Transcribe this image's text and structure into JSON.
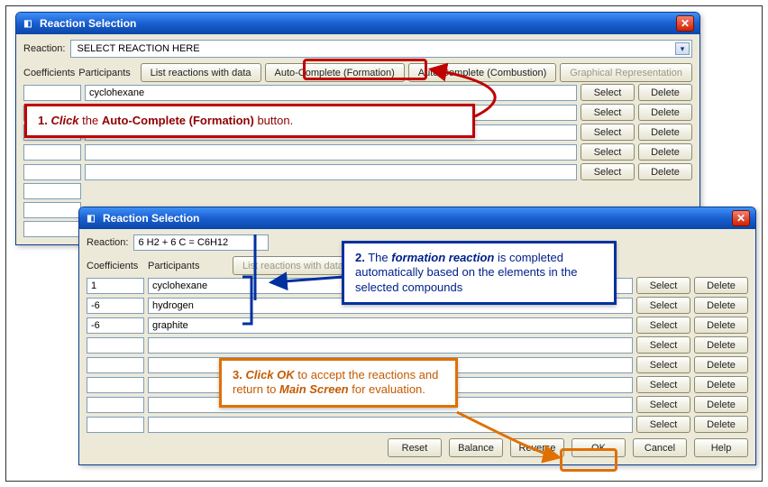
{
  "window1": {
    "title": "Reaction Selection",
    "reaction_label": "Reaction:",
    "reaction_value": "SELECT REACTION HERE",
    "cols": {
      "coef": "Coefficients",
      "part": "Participants"
    },
    "toolbar": {
      "list": "List reactions with data",
      "auto_form": "Auto-Complete (Formation)",
      "auto_comb": "Auto-Complete (Combustion)",
      "graph": "Graphical Representation"
    },
    "rows": [
      {
        "coef": "",
        "part": "cyclohexane"
      },
      {
        "coef": "",
        "part": ""
      },
      {
        "coef": "",
        "part": ""
      },
      {
        "coef": "",
        "part": ""
      },
      {
        "coef": "",
        "part": ""
      }
    ],
    "extra_coefs": [
      "",
      "",
      ""
    ],
    "btn": {
      "select": "Select",
      "delete": "Delete"
    }
  },
  "window2": {
    "title": "Reaction Selection",
    "reaction_label": "Reaction:",
    "reaction_value": "6 H2 + 6 C  =  C6H12",
    "cols": {
      "coef": "Coefficients",
      "part": "Participants"
    },
    "toolbar": {
      "list": "List reactions with data"
    },
    "rows": [
      {
        "coef": "1",
        "part": "cyclohexane"
      },
      {
        "coef": "-6",
        "part": "hydrogen"
      },
      {
        "coef": "-6",
        "part": "graphite"
      },
      {
        "coef": "",
        "part": ""
      },
      {
        "coef": "",
        "part": ""
      },
      {
        "coef": "",
        "part": ""
      },
      {
        "coef": "",
        "part": ""
      },
      {
        "coef": "",
        "part": ""
      }
    ],
    "btn": {
      "select": "Select",
      "delete": "Delete"
    },
    "strip": {
      "reset": "Reset",
      "balance": "Balance",
      "reverse": "Reverse",
      "ok": "OK",
      "cancel": "Cancel",
      "help": "Help"
    }
  },
  "callouts": {
    "c1": {
      "num": "1.",
      "t1": "Click",
      "t2": " the ",
      "t3": "Auto-Complete (Formation)",
      "t4": " button."
    },
    "c2": {
      "num": "2.",
      "t1": " The ",
      "t2": "formation reaction",
      "t3": " is completed automatically based on the elements in the selected  compounds"
    },
    "c3": {
      "num": "3.",
      "t1": "Click OK",
      "t2": " to accept the reactions and return to ",
      "t3": "Main Screen",
      "t4": " for evaluation."
    }
  }
}
